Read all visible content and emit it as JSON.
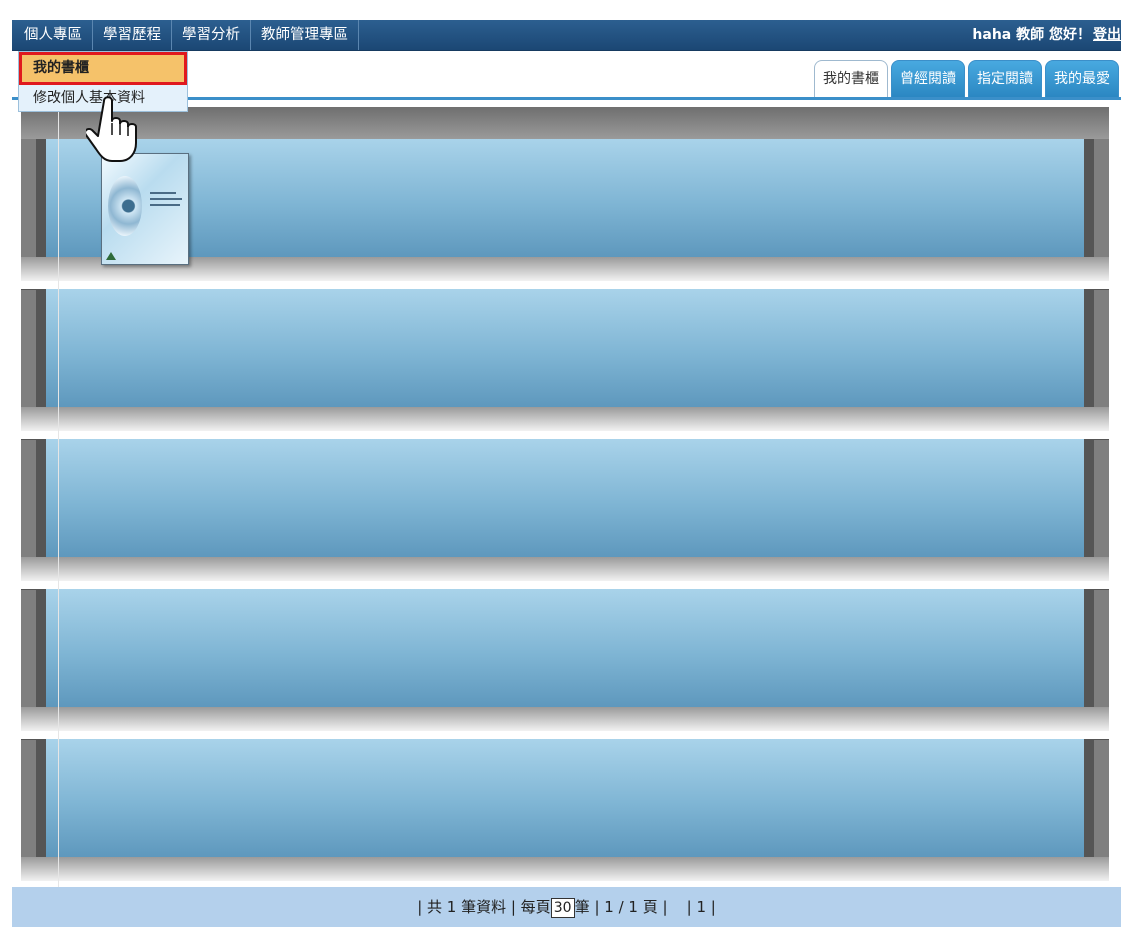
{
  "nav": {
    "items": [
      "個人專區",
      "學習歷程",
      "學習分析",
      "教師管理專區"
    ],
    "greeting": "haha 教師 您好！",
    "logout": "登出"
  },
  "dropdown": {
    "active": "我的書櫃",
    "sub": "修改個人基本資料"
  },
  "tabs": [
    {
      "label": "我的書櫃",
      "active": true
    },
    {
      "label": "曾經閱讀",
      "active": false
    },
    {
      "label": "指定閱讀",
      "active": false
    },
    {
      "label": "我的最愛",
      "active": false
    }
  ],
  "shelves": {
    "count": 5,
    "books": [
      {
        "shelf": 1,
        "title": "",
        "cover": "book-cover-eye-image"
      }
    ]
  },
  "footer": {
    "prefix": "| 共 1 筆資料 | 每頁",
    "page_size": "30",
    "suffix": "筆 | 1 / 1 頁 |",
    "page_link": "| 1 |"
  },
  "colors": {
    "nav_bg": "#1f4d7c",
    "tab_active_border": "#9fb9cf",
    "tab_inactive_bg": "#3697d3",
    "dropdown_highlight": "#f5c26a",
    "highlight_outline": "#e0191e",
    "footer_bg": "#b4d0ec",
    "shelf_back": "#7fb5d4"
  }
}
